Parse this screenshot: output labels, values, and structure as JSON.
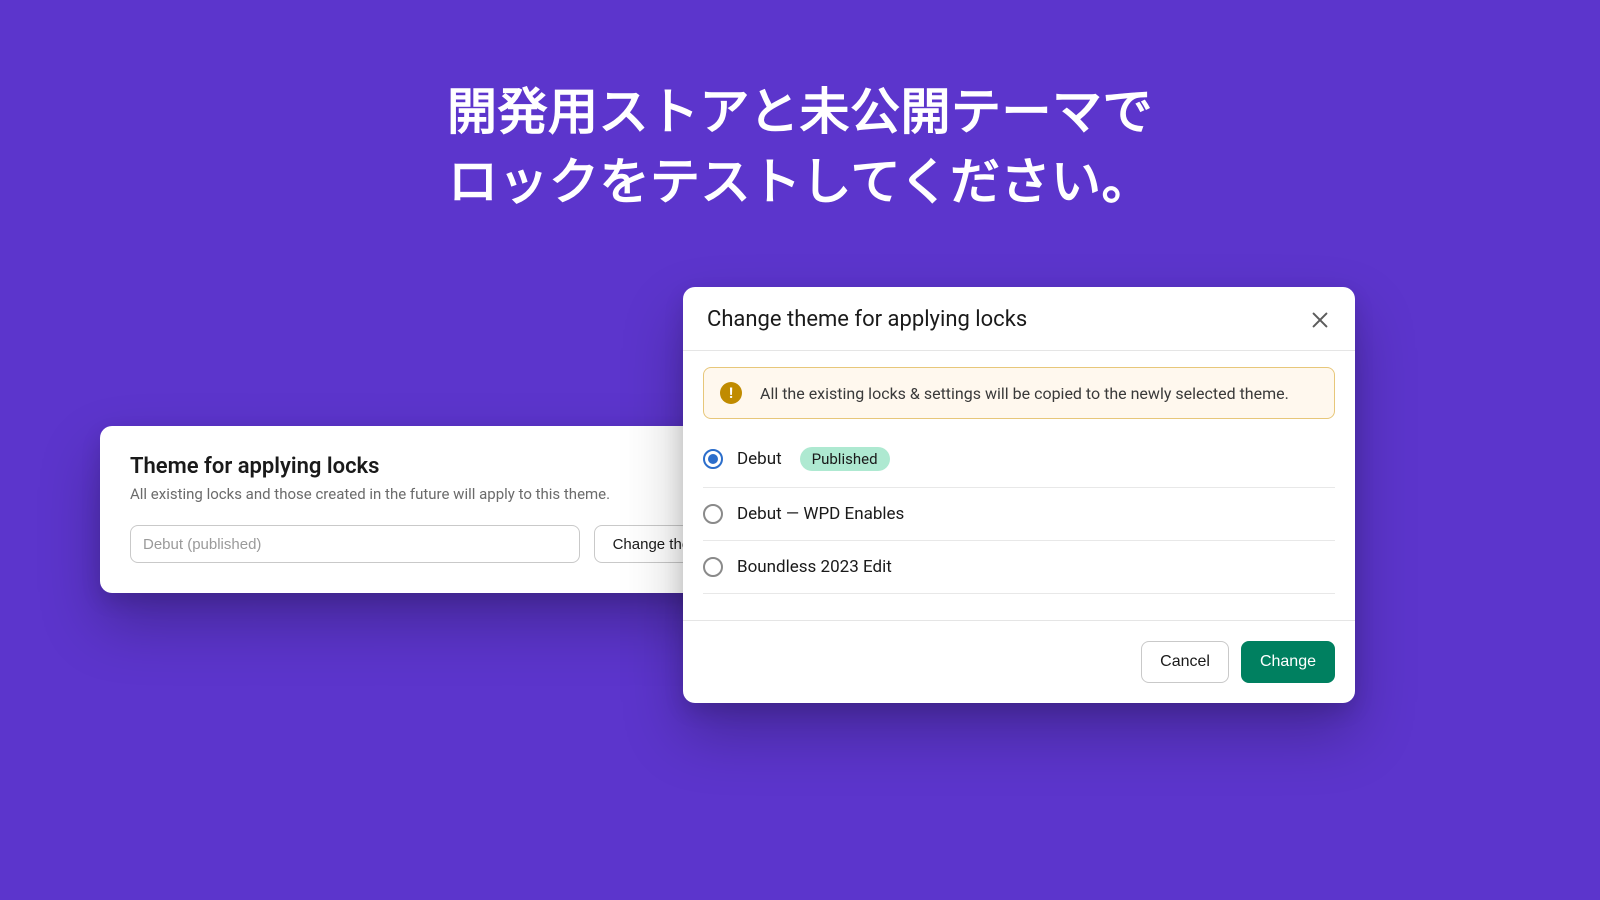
{
  "headline": {
    "line1": "開発用ストアと未公開テーマで",
    "line2": "ロックをテストしてください。"
  },
  "settings_card": {
    "title": "Theme for applying locks",
    "description": "All existing locks and those created in the future will apply to this theme.",
    "input_value": "Debut (published)",
    "change_button": "Change theme"
  },
  "modal": {
    "title": "Change theme for applying locks",
    "alert": {
      "icon_glyph": "!",
      "text": "All the existing locks & settings will be copied to the newly selected theme."
    },
    "options": [
      {
        "label": "Debut",
        "selected": true,
        "badge": "Published"
      },
      {
        "label": "Debut — WPD Enables",
        "selected": false
      },
      {
        "label": "Boundless 2023 Edit",
        "selected": false
      }
    ],
    "cancel_button": "Cancel",
    "confirm_button": "Change"
  }
}
